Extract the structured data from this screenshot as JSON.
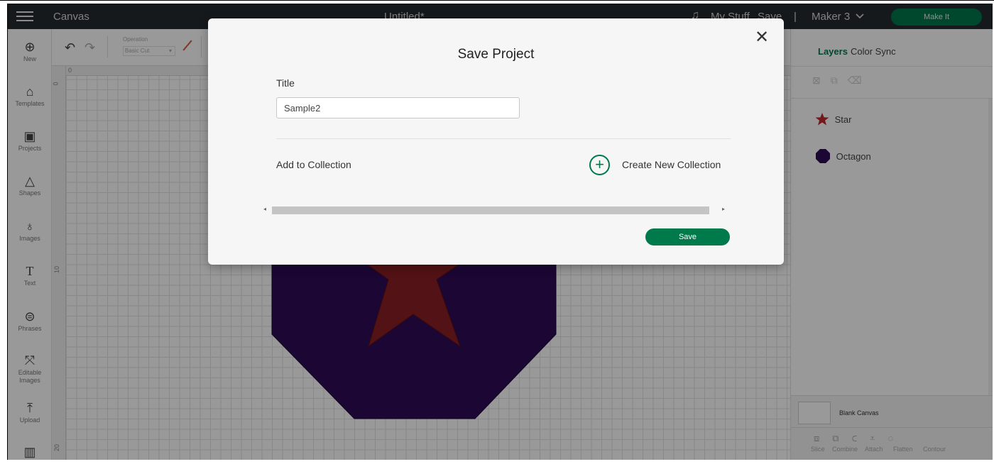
{
  "header": {
    "app_title": "Canvas",
    "doc_title": "Untitled*",
    "my_stuff": "My Stuff",
    "save": "Save",
    "separator": "|",
    "machine": "Maker 3",
    "machine_icon": "chevron-down-icon",
    "make_it": "Make It"
  },
  "left_toolbar": {
    "items": [
      {
        "label": "New",
        "icon": "plus-circle-icon"
      },
      {
        "label": "Templates",
        "icon": "shirt-icon"
      },
      {
        "label": "Projects",
        "icon": "projects-icon"
      },
      {
        "label": "Shapes",
        "icon": "shapes-icon"
      },
      {
        "label": "Images",
        "icon": "bulb-icon"
      },
      {
        "label": "Text",
        "icon": "text-icon"
      },
      {
        "label": "Phrases",
        "icon": "speech-icon"
      },
      {
        "label": "Editable Images",
        "icon": "editable-images-icon"
      },
      {
        "label": "Upload",
        "icon": "upload-icon"
      }
    ]
  },
  "edit_toolbar": {
    "operation_label": "Operation",
    "operation_value": "Basic Cut"
  },
  "ruler": {
    "h0": "0",
    "v0": "0",
    "v10": "10",
    "v20": "20"
  },
  "right_panel": {
    "tabs": [
      {
        "label": "Layers"
      },
      {
        "label": "Color Sync"
      }
    ],
    "layers": [
      {
        "name": "Star",
        "color": "#c0282e"
      },
      {
        "name": "Octagon",
        "color": "#2d0b57"
      }
    ],
    "blank_canvas": "Blank Canvas",
    "bottom_tools": [
      "Slice",
      "Combine",
      "Attach",
      "Flatten",
      "Contour"
    ]
  },
  "modal": {
    "title": "Save Project",
    "title_label": "Title",
    "title_value": "Sample2",
    "add_to_collection": "Add to Collection",
    "create_new_collection": "Create New Collection",
    "save_button": "Save"
  },
  "colors": {
    "accent": "#00794b",
    "star": "#c0282e",
    "octagon": "#2d0b57",
    "header": "#252a2f"
  }
}
